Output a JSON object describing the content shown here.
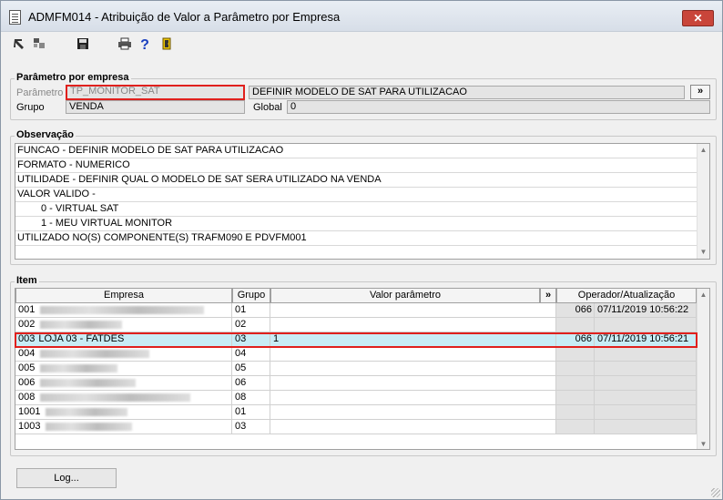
{
  "window": {
    "title": "ADMFM014 - Atribuição de Valor a Parâmetro por Empresa",
    "close_label": "✕"
  },
  "toolbar": [
    "back-icon",
    "grid-icon",
    "save-icon",
    "print-icon",
    "help-icon",
    "exit-icon"
  ],
  "param_group": {
    "legend": "Parâmetro por empresa",
    "param_label": "Parâmetro",
    "param_value": "TP_MONITOR_SAT",
    "desc_value": "DEFINIR MODELO DE SAT PARA UTILIZACAO",
    "expand_label": "»",
    "group_label": "Grupo",
    "group_value": "VENDA",
    "global_label": "Global",
    "global_value": "0"
  },
  "obs": {
    "legend": "Observação",
    "lines": [
      "FUNCAO - DEFINIR MODELO DE SAT PARA UTILIZACAO",
      "FORMATO - NUMERICO",
      "UTILIDADE - DEFINIR QUAL O MODELO DE SAT SERA UTILIZADO NA VENDA",
      "VALOR VALIDO -",
      "0 - VIRTUAL SAT",
      "1 - MEU VIRTUAL MONITOR",
      "UTILIZADO NO(S) COMPONENTE(S) TRAFM090 E PDVFM001"
    ]
  },
  "items": {
    "legend": "Item",
    "headers": {
      "empresa": "Empresa",
      "grupo": "Grupo",
      "valor": "Valor parâmetro",
      "expand": "»",
      "operador": "Operador/Atualização"
    },
    "rows": [
      {
        "code": "001",
        "name": "",
        "grupo": "01",
        "valor": "",
        "op": "066",
        "date": "07/11/2019 10:56:22"
      },
      {
        "code": "002",
        "name": "",
        "grupo": "02",
        "valor": "",
        "op": "",
        "date": ""
      },
      {
        "code": "003",
        "name": "LOJA 03 - FATDES",
        "grupo": "03",
        "valor": "1",
        "op": "066",
        "date": "07/11/2019 10:56:21"
      },
      {
        "code": "004",
        "name": "",
        "grupo": "04",
        "valor": "",
        "op": "",
        "date": ""
      },
      {
        "code": "005",
        "name": "",
        "grupo": "05",
        "valor": "",
        "op": "",
        "date": ""
      },
      {
        "code": "006",
        "name": "",
        "grupo": "06",
        "valor": "",
        "op": "",
        "date": ""
      },
      {
        "code": "008",
        "name": "",
        "grupo": "08",
        "valor": "",
        "op": "",
        "date": ""
      },
      {
        "code": "1001",
        "name": "",
        "grupo": "01",
        "valor": "",
        "op": "",
        "date": ""
      },
      {
        "code": "1003",
        "name": "",
        "grupo": "03",
        "valor": "",
        "op": "",
        "date": ""
      }
    ]
  },
  "log_button": "Log..."
}
